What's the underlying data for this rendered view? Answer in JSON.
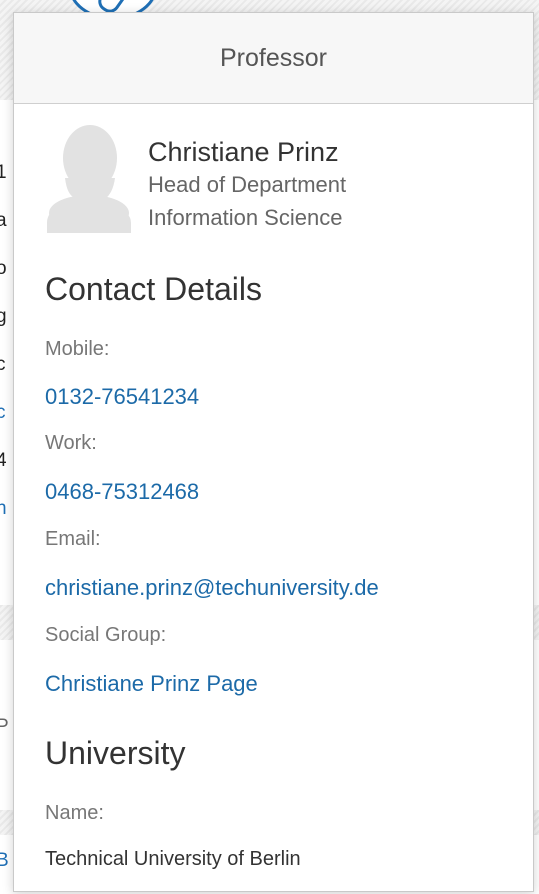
{
  "background": {
    "fragments": [
      "1",
      "a",
      "o",
      "g",
      "c",
      "c",
      "4",
      "n",
      "P",
      "B"
    ]
  },
  "popover": {
    "header_title": "Professor",
    "profile": {
      "name": "Christiane Prinz",
      "role": "Head of Department",
      "department": "Information Science"
    },
    "contact": {
      "title": "Contact Details",
      "mobile_label": "Mobile:",
      "mobile_value": "0132-76541234",
      "work_label": "Work:",
      "work_value": "0468-75312468",
      "email_label": "Email:",
      "email_value": "christiane.prinz@techuniversity.de",
      "social_label": "Social Group:",
      "social_value": "Christiane Prinz Page"
    },
    "university": {
      "title": "University",
      "name_label": "Name:",
      "name_value": "Technical University of Berlin"
    }
  },
  "colors": {
    "link": "#1c6aa8",
    "text_dark": "#333333",
    "text_muted": "#777777",
    "header_bg": "#f7f7f7"
  }
}
